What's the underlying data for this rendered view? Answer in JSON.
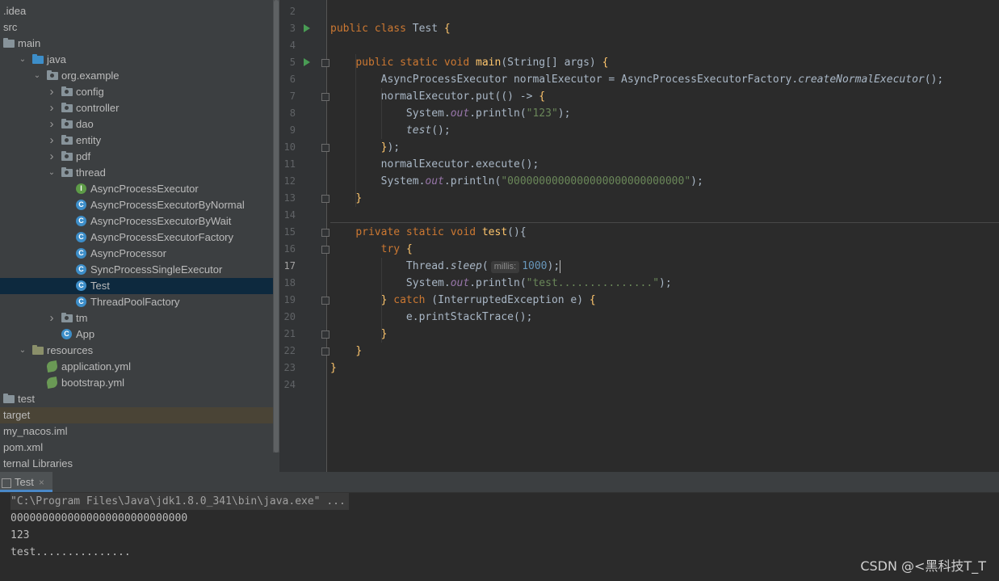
{
  "tree": [
    {
      "label": ".idea",
      "indent": 0,
      "icon": "none",
      "chevron": "none"
    },
    {
      "label": "src",
      "indent": 0,
      "icon": "none",
      "chevron": "none"
    },
    {
      "label": "main",
      "indent": 0,
      "icon": "folder",
      "chevron": "none"
    },
    {
      "label": "java",
      "indent": 1,
      "icon": "folder-blue",
      "chevron": "down"
    },
    {
      "label": "org.example",
      "indent": 2,
      "icon": "package",
      "chevron": "down"
    },
    {
      "label": "config",
      "indent": 3,
      "icon": "package",
      "chevron": "right"
    },
    {
      "label": "controller",
      "indent": 3,
      "icon": "package",
      "chevron": "right"
    },
    {
      "label": "dao",
      "indent": 3,
      "icon": "package",
      "chevron": "right"
    },
    {
      "label": "entity",
      "indent": 3,
      "icon": "package",
      "chevron": "right"
    },
    {
      "label": "pdf",
      "indent": 3,
      "icon": "package",
      "chevron": "right"
    },
    {
      "label": "thread",
      "indent": 3,
      "icon": "package",
      "chevron": "down"
    },
    {
      "label": "AsyncProcessExecutor",
      "indent": 4,
      "icon": "interface",
      "chevron": "none"
    },
    {
      "label": "AsyncProcessExecutorByNormal",
      "indent": 4,
      "icon": "class",
      "chevron": "none"
    },
    {
      "label": "AsyncProcessExecutorByWait",
      "indent": 4,
      "icon": "class",
      "chevron": "none"
    },
    {
      "label": "AsyncProcessExecutorFactory",
      "indent": 4,
      "icon": "class",
      "chevron": "none"
    },
    {
      "label": "AsyncProcessor",
      "indent": 4,
      "icon": "class",
      "chevron": "none"
    },
    {
      "label": "SyncProcessSingleExecutor",
      "indent": 4,
      "icon": "class",
      "chevron": "none"
    },
    {
      "label": "Test",
      "indent": 4,
      "icon": "class-run",
      "chevron": "none",
      "state": "selected"
    },
    {
      "label": "ThreadPoolFactory",
      "indent": 4,
      "icon": "class",
      "chevron": "none"
    },
    {
      "label": "tm",
      "indent": 3,
      "icon": "package",
      "chevron": "right"
    },
    {
      "label": "App",
      "indent": 3,
      "icon": "class-run",
      "chevron": "none"
    },
    {
      "label": "resources",
      "indent": 1,
      "icon": "folder-res",
      "chevron": "down"
    },
    {
      "label": "application.yml",
      "indent": 2,
      "icon": "leaf",
      "chevron": "none"
    },
    {
      "label": "bootstrap.yml",
      "indent": 2,
      "icon": "leaf",
      "chevron": "none"
    },
    {
      "label": "test",
      "indent": 0,
      "icon": "folder",
      "chevron": "none"
    },
    {
      "label": "target",
      "indent": 0,
      "icon": "none",
      "chevron": "none",
      "state": "hl"
    },
    {
      "label": "my_nacos.iml",
      "indent": 0,
      "icon": "none",
      "chevron": "none"
    },
    {
      "label": "pom.xml",
      "indent": 0,
      "icon": "none",
      "chevron": "none"
    },
    {
      "label": "ternal Libraries",
      "indent": 0,
      "icon": "none",
      "chevron": "none"
    }
  ],
  "editor": {
    "line_numbers": [
      "2",
      "3",
      "4",
      "5",
      "6",
      "7",
      "8",
      "9",
      "10",
      "11",
      "12",
      "13",
      "14",
      "15",
      "16",
      "17",
      "18",
      "19",
      "20",
      "21",
      "22",
      "23",
      "24"
    ],
    "current_line": "17",
    "inlay_hint": "millis:",
    "code": [
      [],
      [
        [
          "kw",
          "public class "
        ],
        [
          "",
          "Test "
        ],
        [
          "fn",
          "{"
        ]
      ],
      [],
      [
        [
          "",
          "    "
        ],
        [
          "kw",
          "public static void "
        ],
        [
          "fn",
          "main"
        ],
        [
          "",
          "(String[] args) "
        ],
        [
          "fn",
          "{"
        ]
      ],
      [
        [
          "",
          "        AsyncProcessExecutor normalExecutor = AsyncProcessExecutorFactory."
        ],
        [
          "it",
          "createNormalExecutor"
        ],
        [
          "",
          "();"
        ]
      ],
      [
        [
          "",
          "        normalExecutor.put(() -> "
        ],
        [
          "fn",
          "{"
        ]
      ],
      [
        [
          "",
          "            System."
        ],
        [
          "st",
          "out"
        ],
        [
          "",
          ".println("
        ],
        [
          "str",
          "\"123\""
        ],
        [
          "",
          ");"
        ]
      ],
      [
        [
          "",
          "            "
        ],
        [
          "it",
          "test"
        ],
        [
          "",
          "();"
        ]
      ],
      [
        [
          "",
          "        "
        ],
        [
          "fn",
          "}"
        ],
        [
          "",
          ");"
        ]
      ],
      [
        [
          "",
          "        normalExecutor.execute();"
        ]
      ],
      [
        [
          "",
          "        System."
        ],
        [
          "st",
          "out"
        ],
        [
          "",
          ".println("
        ],
        [
          "str",
          "\"0000000000000000000000000000\""
        ],
        [
          "",
          ");"
        ]
      ],
      [
        [
          "",
          "    "
        ],
        [
          "fn",
          "}"
        ]
      ],
      [],
      [
        [
          "",
          "    "
        ],
        [
          "kw",
          "private static void "
        ],
        [
          "fn",
          "test"
        ],
        [
          "",
          "(){"
        ]
      ],
      [
        [
          "",
          "        "
        ],
        [
          "kw",
          "try "
        ],
        [
          "fn",
          "{"
        ]
      ],
      [
        [
          "",
          "            Thread."
        ],
        [
          "it",
          "sleep"
        ],
        [
          "",
          "("
        ],
        [
          "hint",
          ""
        ],
        [
          "num",
          "1000"
        ],
        [
          "",
          ");"
        ],
        [
          "caret",
          ""
        ]
      ],
      [
        [
          "",
          "            System."
        ],
        [
          "st",
          "out"
        ],
        [
          "",
          ".println("
        ],
        [
          "str",
          "\"test...............\""
        ],
        [
          "",
          ");"
        ]
      ],
      [
        [
          "",
          "        "
        ],
        [
          "fn",
          "}"
        ],
        [
          "kw",
          " catch "
        ],
        [
          "",
          "(InterruptedException e) "
        ],
        [
          "fn",
          "{"
        ]
      ],
      [
        [
          "",
          "            e.printStackTrace();"
        ]
      ],
      [
        [
          "",
          "        "
        ],
        [
          "fn",
          "}"
        ]
      ],
      [
        [
          "",
          "    "
        ],
        [
          "fn",
          "}"
        ]
      ],
      [
        [
          "fn",
          "}"
        ]
      ],
      []
    ]
  },
  "run": {
    "tab_label": "Test",
    "console": [
      "\"C:\\Program Files\\Java\\jdk1.8.0_341\\bin\\java.exe\" ...",
      "0000000000000000000000000000",
      "123",
      "test..............."
    ]
  },
  "watermark": "CSDN @<黑科技T_T"
}
